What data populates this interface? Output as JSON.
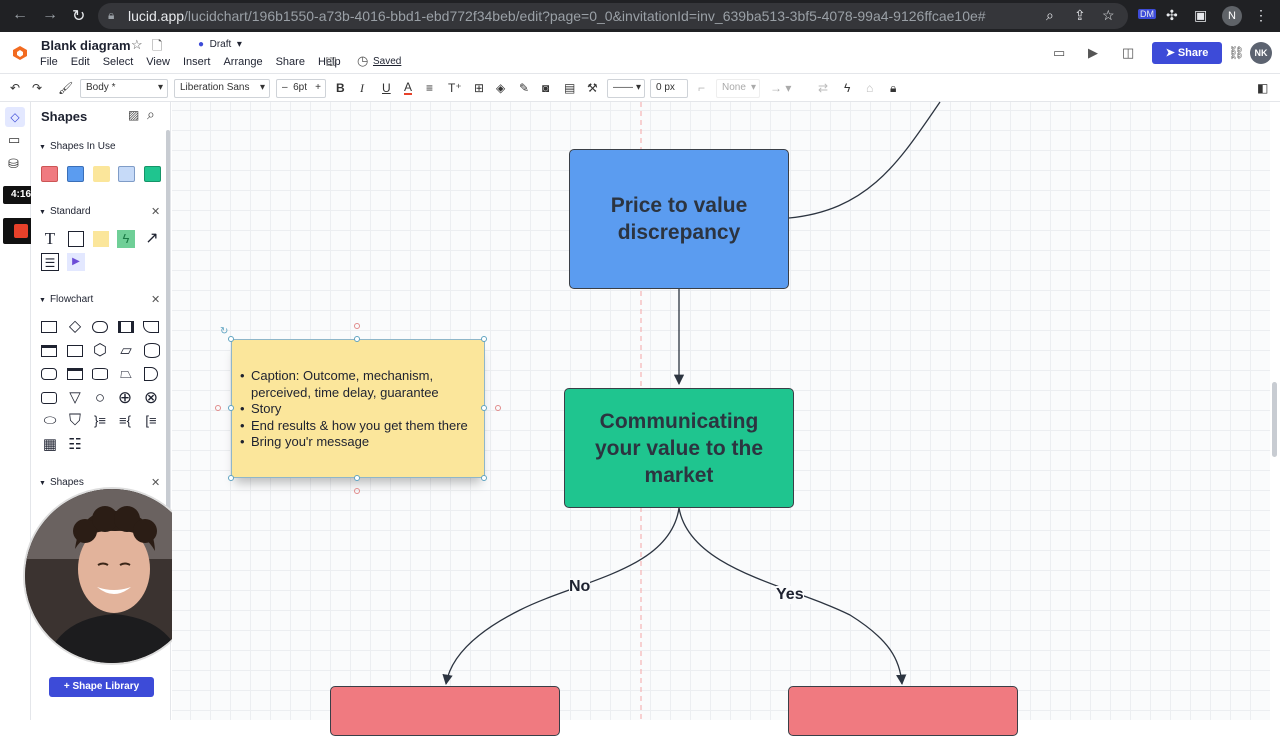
{
  "browser": {
    "url_host": "lucid.app",
    "url_path": "/lucidchart/196b1550-a73b-4016-bbd1-ebd772f34beb/edit?page=0_0&invitationId=inv_639ba513-3bf5-4078-99a4-9126ffcae10e#",
    "profile_initial": "N"
  },
  "header": {
    "title": "Blank diagram",
    "status": "Draft",
    "menus": [
      "File",
      "Edit",
      "Select",
      "View",
      "Insert",
      "Arrange",
      "Share",
      "Help"
    ],
    "saved": "Saved",
    "share_label": "Share",
    "user_initials": "NK"
  },
  "toolbar": {
    "style": "Body *",
    "font": "Liberation Sans",
    "font_size": "6pt",
    "line_width": "0 px",
    "arrow_none": "None"
  },
  "recording": {
    "timer": "4:16"
  },
  "shapes_panel": {
    "title": "Shapes",
    "sections": [
      "Shapes In Use",
      "Standard",
      "Flowchart",
      "Shapes"
    ],
    "library_button": "Shape Library",
    "swatches": [
      "#f07a80",
      "#5b9cf0",
      "#fbe69b",
      "#c6daf8",
      "#1fc58f"
    ]
  },
  "diagram": {
    "box_price": "Price to value discrepancy",
    "box_communicating": "Communicating your value to the market",
    "label_no": "No",
    "label_yes": "Yes",
    "note_items": [
      "Caption: Outcome, mechanism, perceived, time delay, guarantee",
      "Story",
      "End results & how you get them there",
      "Bring you'r message"
    ],
    "colors": {
      "blue": "#5b9cf0",
      "green": "#1fc58f",
      "red": "#f07a80",
      "yellow": "#fbe69b"
    }
  }
}
